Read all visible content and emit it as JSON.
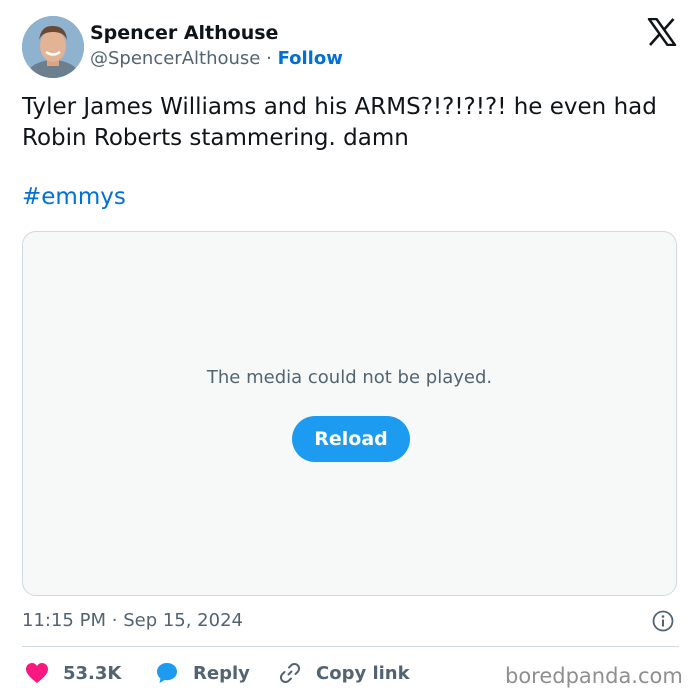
{
  "author": {
    "name": "Spencer Althouse",
    "handle": "@SpencerAlthouse",
    "separator": "·",
    "follow_label": "Follow"
  },
  "tweet": {
    "text": "Tyler James Williams and his ARMS?!?!?!?! he even had Robin Roberts stammering. damn",
    "hashtag": "#emmys"
  },
  "media": {
    "message": "The media could not be played.",
    "reload_label": "Reload"
  },
  "meta": {
    "time": "11:15 PM",
    "dot": "·",
    "date": "Sep 15, 2024"
  },
  "actions": {
    "likes": "53.3K",
    "reply_label": "Reply",
    "copy_label": "Copy link"
  },
  "watermark": "boredpanda.com",
  "colors": {
    "link": "#006fd6",
    "button": "#1d9bf0",
    "heart": "#f91880",
    "secondary_text": "#536471"
  },
  "icons": [
    "x-logo-icon",
    "info-icon",
    "heart-icon",
    "reply-bubble-icon",
    "link-icon"
  ]
}
